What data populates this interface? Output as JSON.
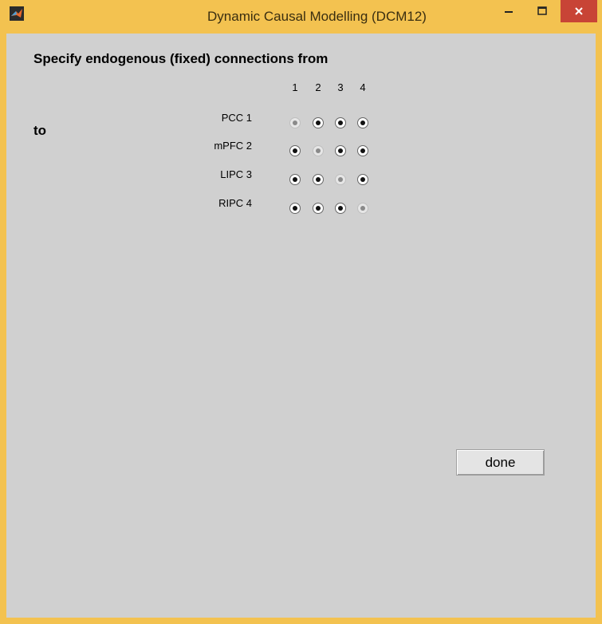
{
  "window": {
    "title": "Dynamic Causal Modelling (DCM12)",
    "minimize_icon": "minimize-icon",
    "maximize_icon": "maximize-icon",
    "close_icon": "close-icon",
    "app_icon": "matlab-logo-icon"
  },
  "panel": {
    "heading": "Specify endogenous (fixed) connections from",
    "to_label": "to",
    "columns": [
      "1",
      "2",
      "3",
      "4"
    ],
    "rows": [
      {
        "label": "PCC 1",
        "states": [
          false,
          true,
          true,
          true
        ]
      },
      {
        "label": "mPFC 2",
        "states": [
          true,
          false,
          true,
          true
        ]
      },
      {
        "label": "LIPC 3",
        "states": [
          true,
          true,
          false,
          true
        ]
      },
      {
        "label": "RIPC 4",
        "states": [
          true,
          true,
          true,
          false
        ]
      }
    ],
    "done_label": "done"
  },
  "colors": {
    "frame": "#f3c250",
    "client_bg": "#d0d0d0",
    "close_button": "#c84436"
  }
}
